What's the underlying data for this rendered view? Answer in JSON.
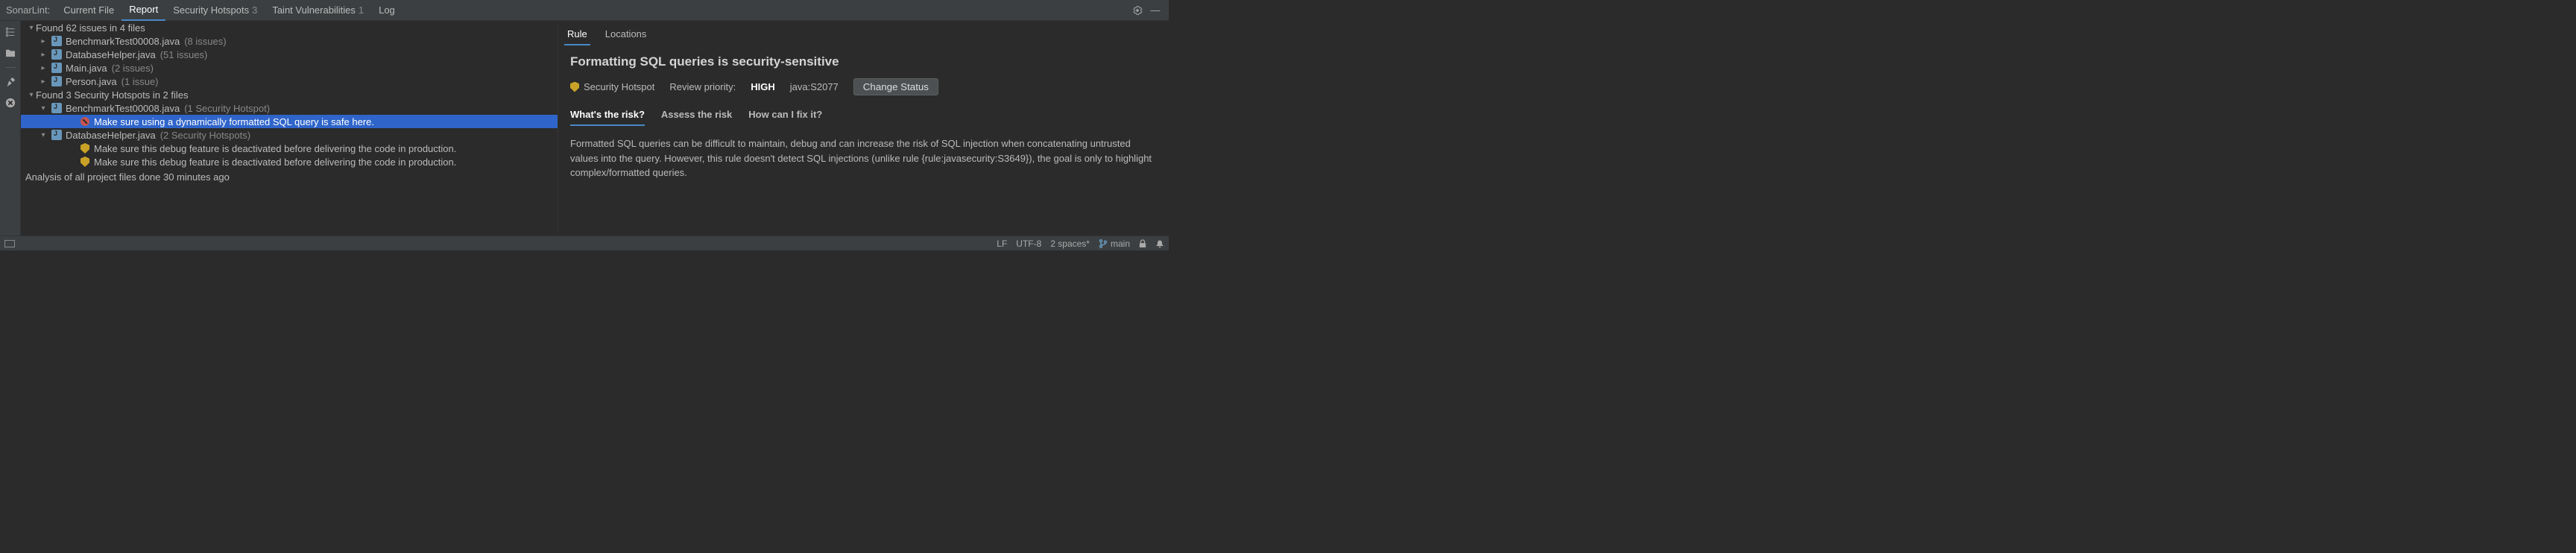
{
  "topbar": {
    "prefix": "SonarLint:",
    "tabs": [
      {
        "label": "Current File",
        "count": "",
        "active": false
      },
      {
        "label": "Report",
        "count": "",
        "active": true
      },
      {
        "label": "Security Hotspots",
        "count": "3",
        "active": false
      },
      {
        "label": "Taint Vulnerabilities",
        "count": "1",
        "active": false
      },
      {
        "label": "Log",
        "count": "",
        "active": false
      }
    ]
  },
  "tree": {
    "rows": [
      {
        "indent": 0,
        "arrow": "▾",
        "icon": "",
        "text": "Found 62 issues in 4 files",
        "meta": "",
        "sel": false
      },
      {
        "indent": 1,
        "arrow": "▸",
        "icon": "java",
        "text": "BenchmarkTest00008.java",
        "meta": "(8 issues)",
        "sel": false
      },
      {
        "indent": 1,
        "arrow": "▸",
        "icon": "java",
        "text": "DatabaseHelper.java",
        "meta": "(51 issues)",
        "sel": false
      },
      {
        "indent": 1,
        "arrow": "▸",
        "icon": "java",
        "text": "Main.java",
        "meta": "(2 issues)",
        "sel": false
      },
      {
        "indent": 1,
        "arrow": "▸",
        "icon": "java",
        "text": "Person.java",
        "meta": "(1 issue)",
        "sel": false
      },
      {
        "indent": 0,
        "arrow": "▾",
        "icon": "",
        "text": "Found 3 Security Hotspots in 2 files",
        "meta": "",
        "sel": false
      },
      {
        "indent": 1,
        "arrow": "▾",
        "icon": "java",
        "text": "BenchmarkTest00008.java",
        "meta": "(1 Security Hotspot)",
        "sel": false
      },
      {
        "indent": 3,
        "arrow": "",
        "icon": "block",
        "text": "Make sure using a dynamically formatted SQL query is safe here.",
        "meta": "",
        "sel": true
      },
      {
        "indent": 1,
        "arrow": "▾",
        "icon": "java",
        "text": "DatabaseHelper.java",
        "meta": "(2 Security Hotspots)",
        "sel": false
      },
      {
        "indent": 3,
        "arrow": "",
        "icon": "shield",
        "text": "Make sure this debug feature is deactivated before delivering the code in production.",
        "meta": "",
        "sel": false
      },
      {
        "indent": 3,
        "arrow": "",
        "icon": "shield",
        "text": "Make sure this debug feature is deactivated before delivering the code in production.",
        "meta": "",
        "sel": false
      }
    ],
    "footer": "Analysis of all project files done 30 minutes ago"
  },
  "detail": {
    "tabs": [
      {
        "label": "Rule",
        "active": true
      },
      {
        "label": "Locations",
        "active": false
      }
    ],
    "title": "Formatting SQL queries is security-sensitive",
    "type_label": "Security Hotspot",
    "priority_label": "Review priority:",
    "priority_value": "HIGH",
    "rule_id": "java:S2077",
    "change_btn": "Change Status",
    "subtabs": [
      {
        "label": "What's the risk?",
        "active": true
      },
      {
        "label": "Assess the risk",
        "active": false
      },
      {
        "label": "How can I fix it?",
        "active": false
      }
    ],
    "body": "Formatted SQL queries can be difficult to maintain, debug and can increase the risk of SQL injection when concatenating untrusted values into the query. However, this rule doesn't detect SQL injections (unlike rule {rule:javasecurity:S3649}), the goal is only to highlight complex/formatted queries."
  },
  "statusbar": {
    "lf": "LF",
    "encoding": "UTF-8",
    "indent": "2 spaces*",
    "branch": "main"
  }
}
